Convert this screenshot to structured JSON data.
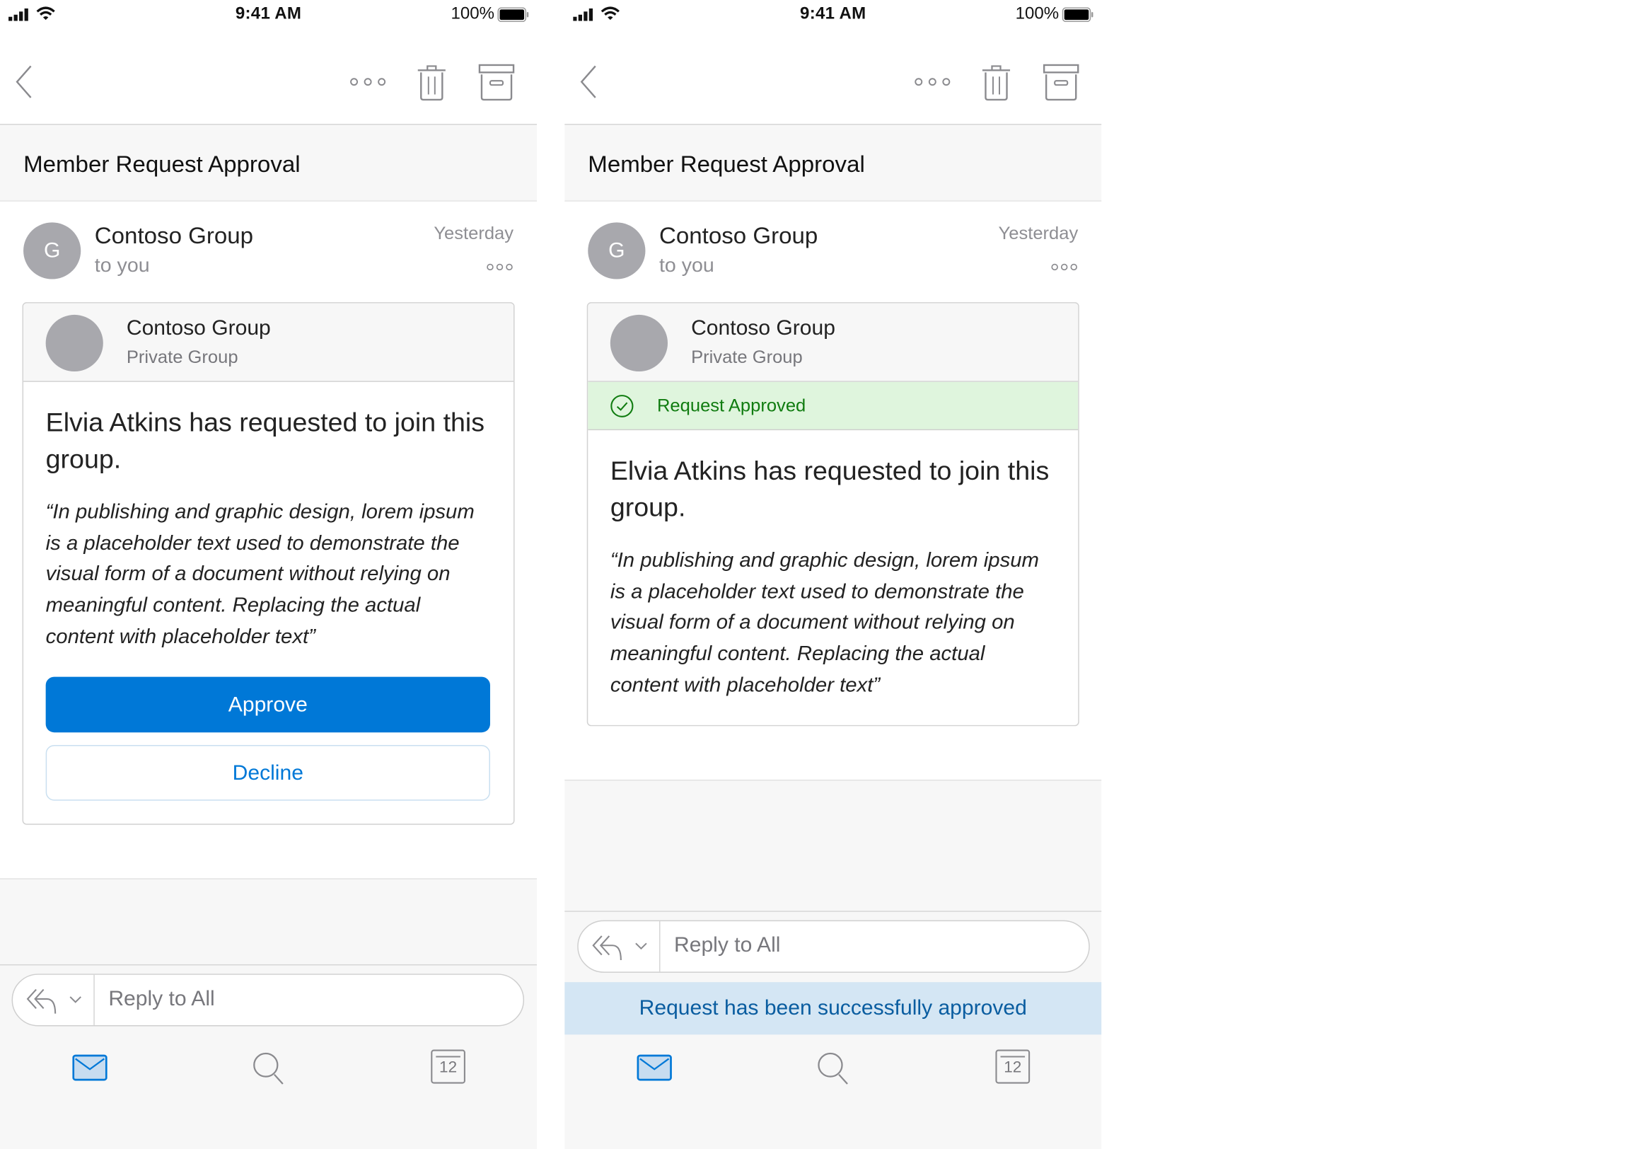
{
  "screens": [
    {
      "state": "pending",
      "status_bar": {
        "time": "9:41 AM",
        "battery": "100%"
      },
      "nav": {
        "back": "back-icon",
        "more": "more-icon",
        "delete": "trash-icon",
        "archive": "archive-icon"
      },
      "subject": "Member Request Approval",
      "message": {
        "avatar_initial": "G",
        "sender": "Contoso Group",
        "recipient": "to you",
        "date": "Yesterday"
      },
      "card": {
        "group_name": "Contoso Group",
        "group_type": "Private Group",
        "title": "Elvia Atkins has requested to join this group.",
        "quote": "“In publishing and graphic design, lorem ipsum is a placeholder text used to demonstrate the visual form of a document without relying on meaningful content. Replacing the actual content with placeholder text”",
        "approve_label": "Approve",
        "decline_label": "Decline"
      },
      "reply": {
        "placeholder": "Reply to All"
      },
      "tabbar": {
        "mail": "mail-icon",
        "search": "search-icon",
        "calendar": "calendar-icon",
        "calendar_day": "12",
        "active": "mail"
      }
    },
    {
      "state": "approved",
      "status_bar": {
        "time": "9:41 AM",
        "battery": "100%"
      },
      "nav": {
        "back": "back-icon",
        "more": "more-icon",
        "delete": "trash-icon",
        "archive": "archive-icon"
      },
      "subject": "Member Request Approval",
      "message": {
        "avatar_initial": "G",
        "sender": "Contoso Group",
        "recipient": "to you",
        "date": "Yesterday"
      },
      "card": {
        "group_name": "Contoso Group",
        "group_type": "Private Group",
        "status_label": "Request Approved",
        "title": "Elvia Atkins has requested to join this group.",
        "quote": "“In publishing and graphic design, lorem ipsum is a placeholder text used to demonstrate the visual form of a document without relying on meaningful content. Replacing the actual content with placeholder text”"
      },
      "reply": {
        "placeholder": "Reply to All"
      },
      "toast": "Request has been successfully approved",
      "tabbar": {
        "mail": "mail-icon",
        "search": "search-icon",
        "calendar": "calendar-icon",
        "calendar_day": "12",
        "active": "mail"
      }
    }
  ],
  "colors": {
    "accent": "#0078d7",
    "approved_bg": "#dff5dd",
    "approved_text": "#107c10",
    "toast_bg": "#d4e6f4",
    "toast_text": "#0a5da0",
    "avatar": "#a8a8ad"
  }
}
